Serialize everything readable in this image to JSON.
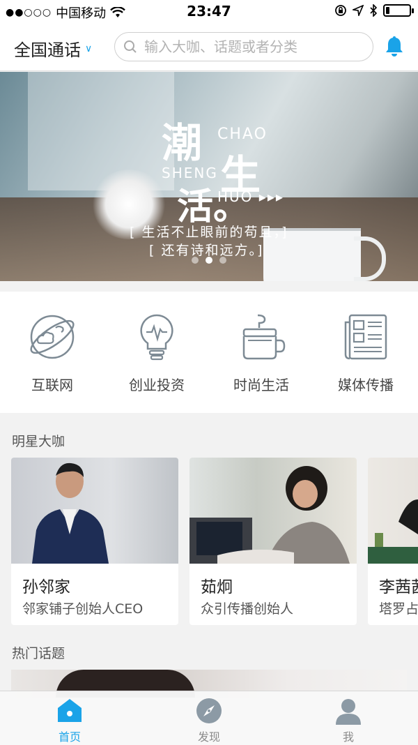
{
  "status_bar": {
    "signal": "●●○○○",
    "carrier": "中国移动",
    "time": "23:47",
    "battery_level": 0.15
  },
  "header": {
    "city": "全国通话",
    "search_placeholder": "输入大咖、话题或者分类"
  },
  "banner": {
    "title_1": "潮",
    "title_2": "生",
    "title_3": "活。",
    "pinyin_1": "CHAO",
    "pinyin_2": "SHENG",
    "pinyin_3": "HUO ▸▸▸",
    "line_1": "[ 生活不止眼前的苟且，]",
    "line_2": "[ 还有诗和远方。]",
    "page_count": 3,
    "active_page": 2
  },
  "categories": [
    {
      "label": "互联网",
      "icon": "globe-icon"
    },
    {
      "label": "创业投资",
      "icon": "lightbulb-icon"
    },
    {
      "label": "时尚生活",
      "icon": "coffee-cup-icon"
    },
    {
      "label": "媒体传播",
      "icon": "newspaper-icon"
    }
  ],
  "stars_section": {
    "title": "明星大咖",
    "cards": [
      {
        "name": "孙邻家",
        "title": "邻家铺子创始人CEO"
      },
      {
        "name": "茹炯",
        "title": "众引传播创始人"
      },
      {
        "name": "李茜茜",
        "title": "塔罗占卜师"
      }
    ]
  },
  "hot_section": {
    "title": "热门话题"
  },
  "tabs": [
    {
      "label": "首页",
      "icon": "home-icon",
      "active": true
    },
    {
      "label": "发现",
      "icon": "compass-icon",
      "active": false
    },
    {
      "label": "我",
      "icon": "user-icon",
      "active": false
    }
  ],
  "colors": {
    "accent": "#1aa3e8",
    "icon_gray": "#7d8a94"
  }
}
